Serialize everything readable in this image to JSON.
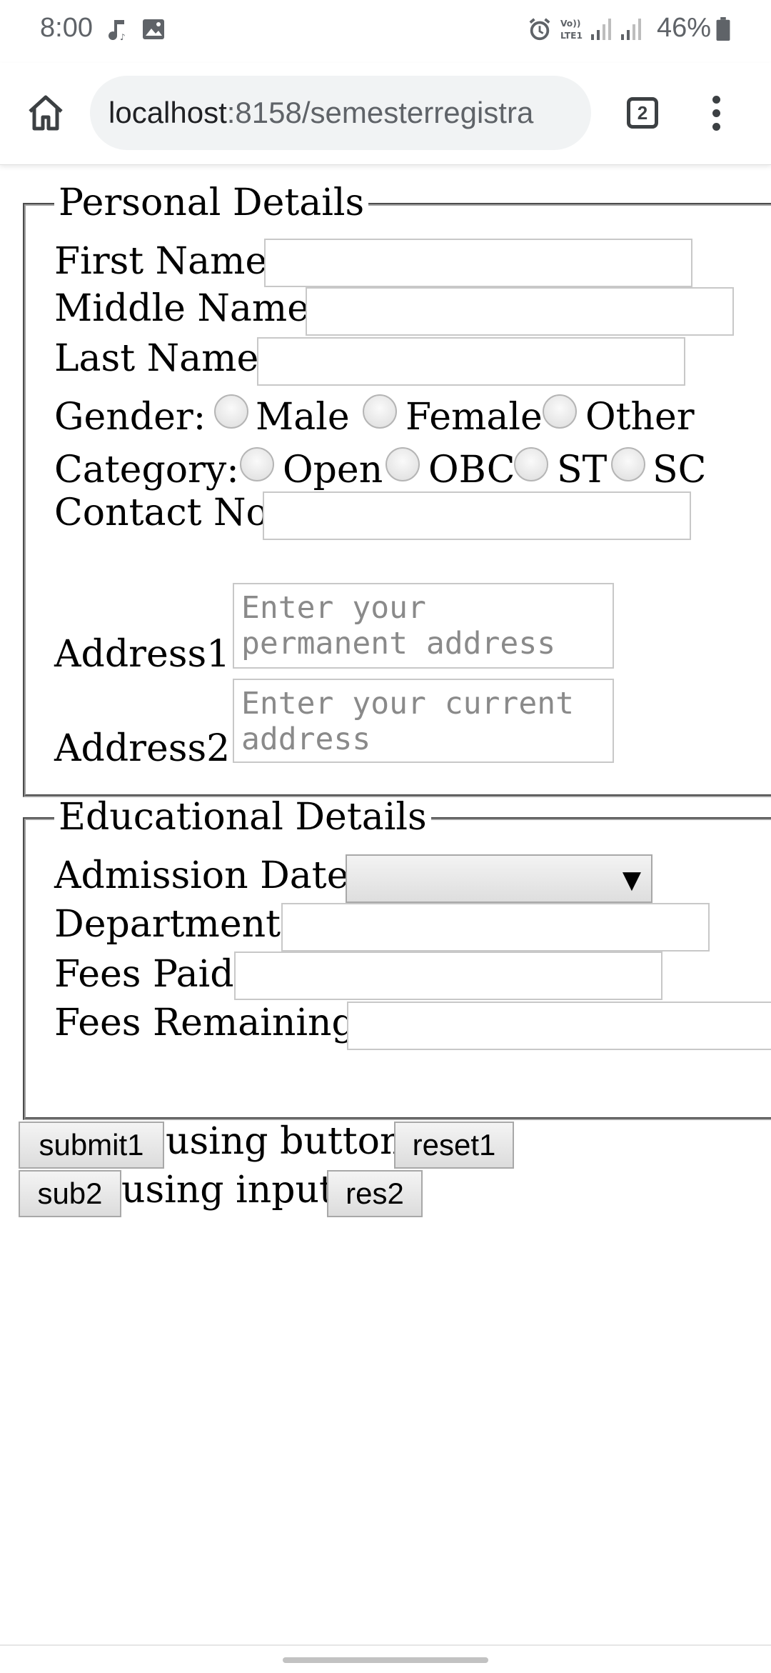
{
  "status_bar": {
    "time": "8:00",
    "battery": "46%",
    "icons": [
      "music-note-icon",
      "image-icon",
      "alarm-icon",
      "volte-icon",
      "signal-icon",
      "signal-icon",
      "battery-icon"
    ]
  },
  "browser": {
    "url_host": "localhost",
    "url_rest": ":8158/semesterregistra",
    "tab_count": "2"
  },
  "personal": {
    "legend": "Personal Details",
    "first_name_label": "First Name:",
    "middle_name_label": "Middle Name:",
    "last_name_label": "Last Name:",
    "gender_label": "Gender:",
    "gender_options": [
      "Male",
      "Female",
      "Other"
    ],
    "category_label": "Category:",
    "category_options": [
      "Open",
      "OBC",
      "ST",
      "SC"
    ],
    "contact_label": "Contact No:",
    "address1_label": "Address1:",
    "address1_placeholder": "Enter your permanent address",
    "address2_label": "Address2:",
    "address2_placeholder": "Enter your current address"
  },
  "educational": {
    "legend": "Educational Details",
    "admission_label": "Admission Date:",
    "department_label": "Department:",
    "fees_paid_label": "Fees Paid:",
    "fees_remaining_label": "Fees Remaining:"
  },
  "buttons": {
    "submit1": "submit1",
    "using_button": "using button",
    "reset1": "reset1",
    "sub2": "sub2",
    "using_input": "using input",
    "res2": "res2"
  }
}
